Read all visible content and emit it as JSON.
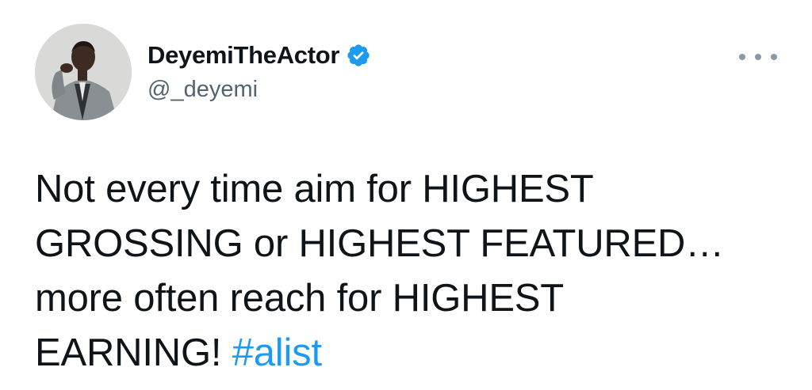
{
  "author": {
    "display_name": "DeyemiTheActor",
    "handle": "@_deyemi",
    "verified": true,
    "avatar_icon": "profile-photo",
    "verified_icon": "verified-badge-icon",
    "verified_color": "#1d9bf0"
  },
  "menu": {
    "icon": "more-options-icon"
  },
  "tweet": {
    "lines": [
      "Not every time aim for HIGHEST",
      "GROSSING or HIGHEST FEATURED…",
      "more often reach for HIGHEST",
      "EARNING! "
    ],
    "hashtag": "#alist",
    "hashtag_color": "#1d9bf0"
  }
}
